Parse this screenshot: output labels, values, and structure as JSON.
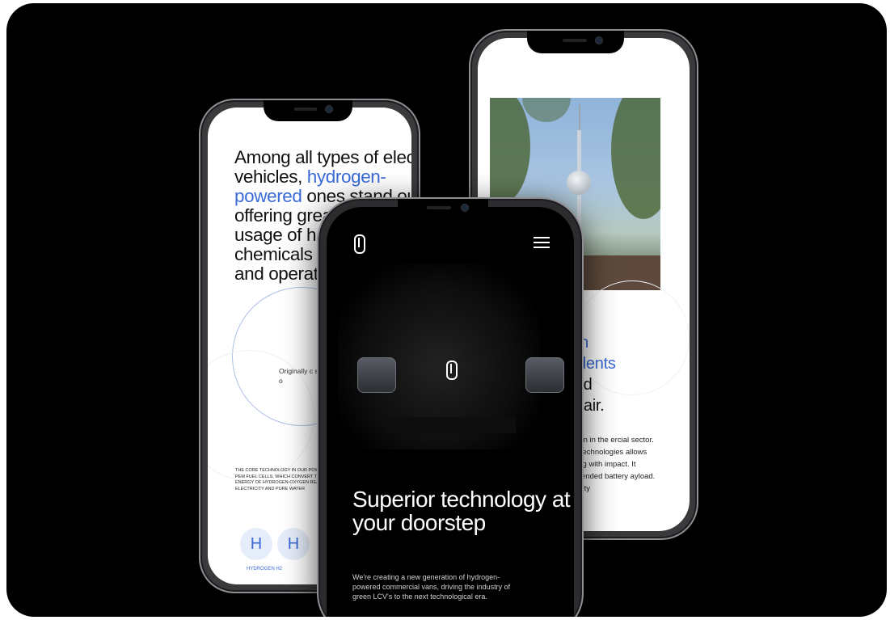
{
  "left_phone": {
    "headline_before": "Among all types of electric vehicles, ",
    "headline_highlight": "hydrogen-powered",
    "headline_after": " ones stand out offering great performance usage of harmful chemicals b production, a and operatio",
    "small_text": "Originally c spacecraft potential o",
    "caps_text": "THE CORE TECHNOLOGY IN OUR POWETRAIN IS PEM FUEL CELLS, WHICH CONVERT THE CHEMICAL ENERGY OF HYDROGEN-OXYGEN REACTION INTO ELECTRICITY AND PURE WATER",
    "h_symbol_1": "H",
    "h_symbol_2": "H",
    "h_label": "HYDROGEN H2"
  },
  "right_phone": {
    "heading_highlight_1": "ollution",
    "heading_highlight_2": "d residents",
    "heading_line_3": "or rapid",
    "heading_line_4": "eaner air.",
    "paragraph": "nate solution in the ercial sector. The use d technologies allows ciency along with impact. It provides xtended battery ayload. The durability"
  },
  "front_phone": {
    "hero_title": "Superior technology at your doorstep",
    "hero_subtitle": "We're creating a new generation of hydrogen-powered commercial vans, driving the industry of green LCV's to the next technological era."
  }
}
